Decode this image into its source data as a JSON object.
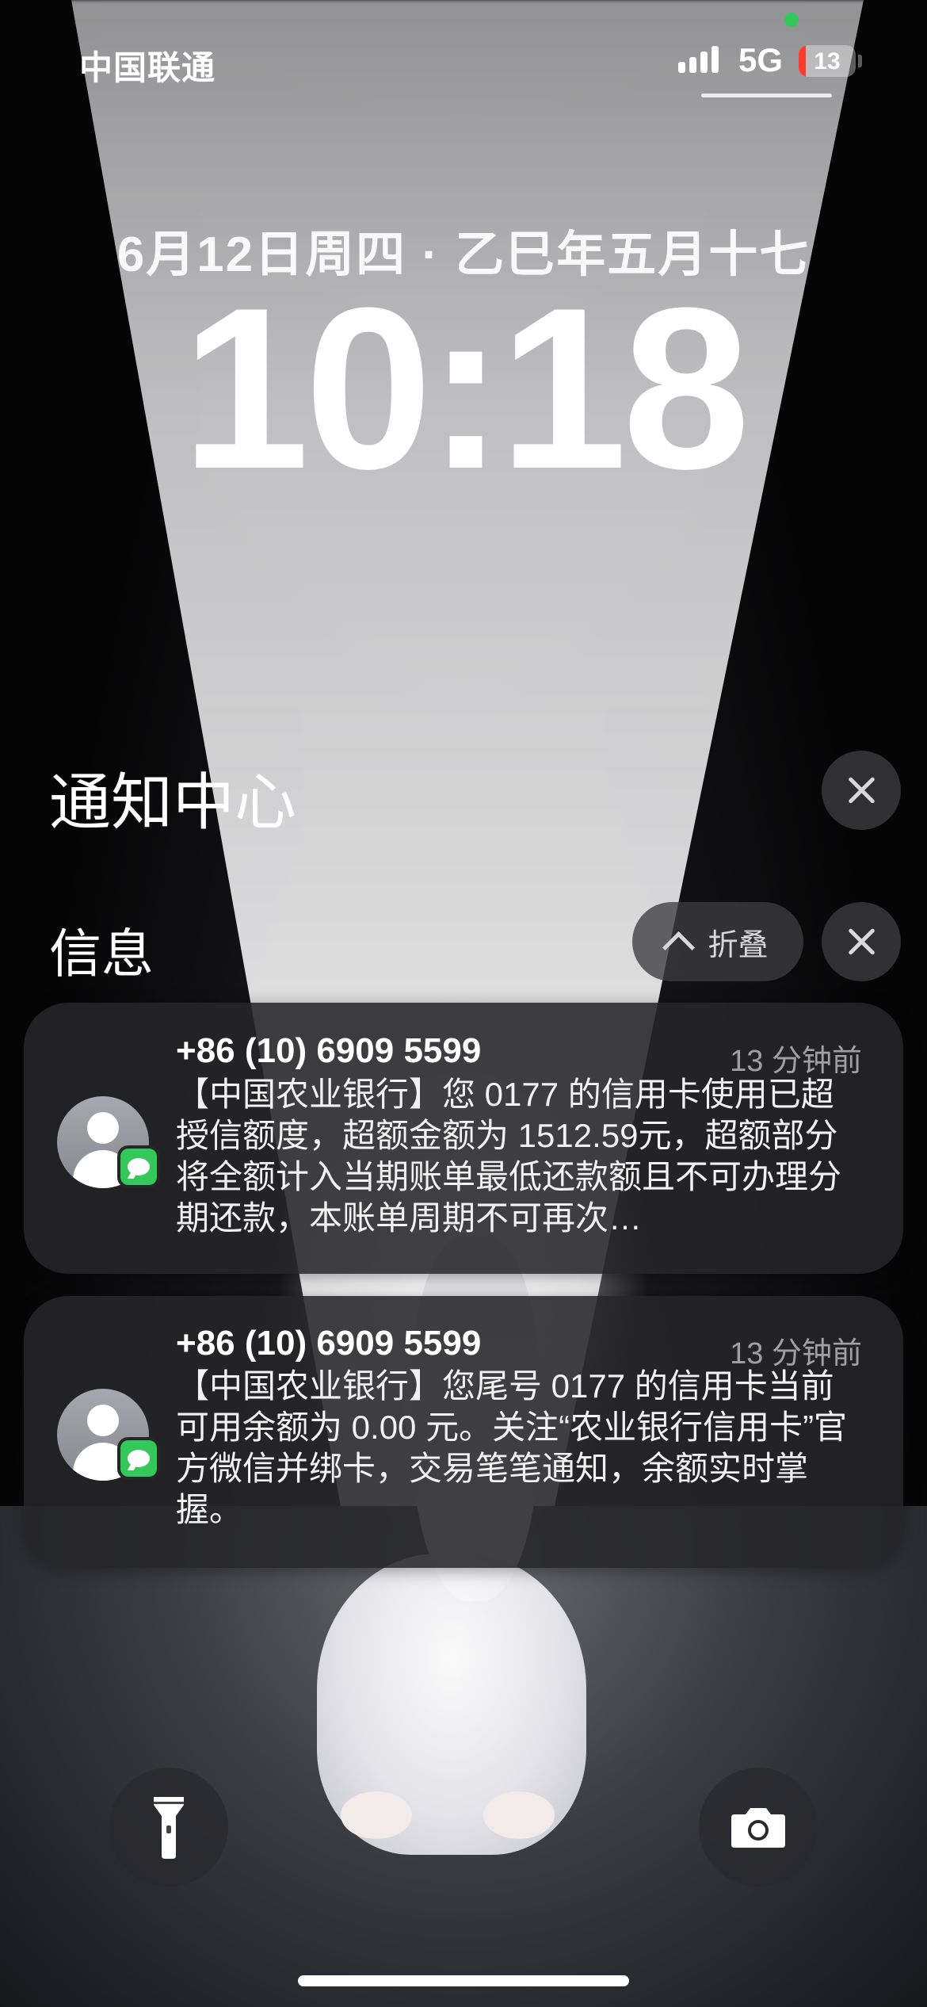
{
  "status_bar": {
    "carrier": "中国联通",
    "network": "5G",
    "battery_percent": "13",
    "battery_level": 0.13,
    "battery_color": "#ff3b30",
    "privacy_dot_color": "#34c759"
  },
  "lock_screen": {
    "date": "6月12日周四 · 乙巳年五月十七",
    "time": "10:18"
  },
  "notification_center": {
    "title": "通知中心",
    "section_title": "信息",
    "collapse_label": "折叠",
    "notifications": [
      {
        "sender": "+86 (10) 6909 5599",
        "timestamp": "13 分钟前",
        "body": "【中国农业银行】您 0177 的信用卡使用已超授信额度，超额金额为 1512.59元，超额部分将全额计入当期账单最低还款额且不可办理分期还款，本账单周期不可再次…"
      },
      {
        "sender": "+86 (10) 6909 5599",
        "timestamp": "13 分钟前",
        "body": "【中国农业银行】您尾号 0177 的信用卡当前可用余额为 0.00 元。关注“农业银行信用卡”官方微信并绑卡，交易笔笔通知，余额实时掌握。"
      }
    ]
  },
  "icons": {
    "close": "close-icon",
    "chevron": "chevron-up-icon",
    "flashlight": "flashlight-icon",
    "camera": "camera-icon",
    "messages_badge": "messages-app-icon"
  }
}
